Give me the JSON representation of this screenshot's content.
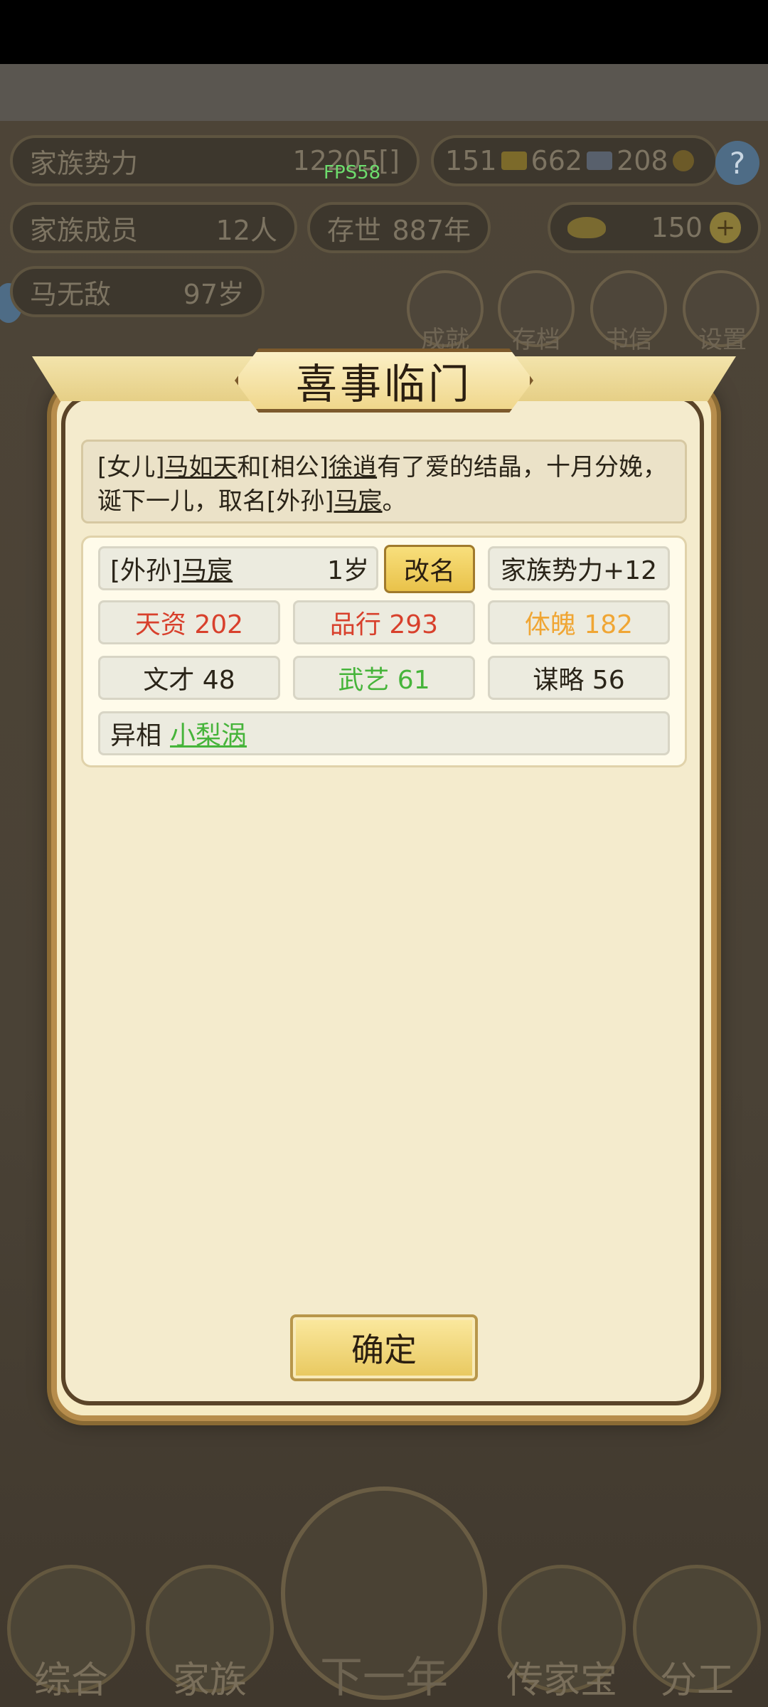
{
  "hud": {
    "family_power_label": "家族势力",
    "family_power_value": "12205[",
    "family_power_suffix": "]",
    "fps": "FPS58",
    "gold": "151",
    "silver": "662",
    "coin": "208",
    "help": "?",
    "members_label": "家族成员",
    "members_value": "12人",
    "existence_label": "存世",
    "existence_value": "887年",
    "ingot_value": "150",
    "plus": "+",
    "patriarch_name": "马无敌",
    "patriarch_age": "97岁"
  },
  "menu": {
    "achievements": "成就",
    "save": "存档",
    "letters": "书信",
    "settings": "设置"
  },
  "modal": {
    "title": "喜事临门",
    "message": {
      "p1": "[女儿]",
      "p2": "马如天",
      "p3": "和[相公]",
      "p4": "徐逍",
      "p5": "有了爱的结晶，十月分娩，诞下一儿，取名[外孙]",
      "p6": "马宸",
      "p7": "。"
    },
    "child": {
      "relation": "[外孙]",
      "name": "马宸",
      "age": "1岁",
      "rename": "改名",
      "power_bonus": "家族势力+12"
    },
    "stats": {
      "talent": "天资 202",
      "conduct": "品行 293",
      "physique": "体魄 182",
      "literary": "文才 48",
      "martial": "武艺 61",
      "strategy": "谋略 56"
    },
    "trait_label": "异相",
    "trait_value": "小梨涡",
    "confirm": "确定"
  },
  "nav": {
    "general": "综合",
    "family": "家族",
    "next_year": "下一年",
    "heirloom": "传家宝",
    "division": "分工"
  },
  "colors": {
    "red_stat": "#d8402c",
    "orange_stat": "#f0a634",
    "green_stat": "#46b43a"
  }
}
